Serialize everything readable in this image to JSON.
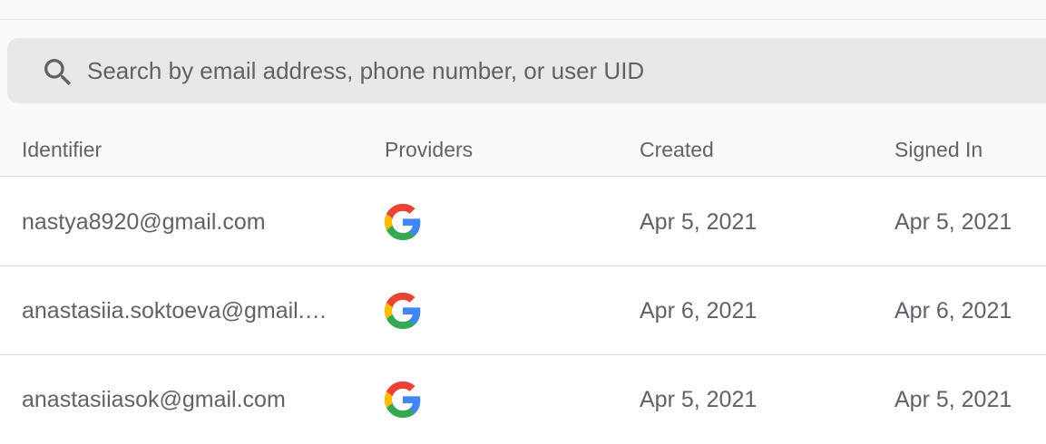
{
  "search": {
    "placeholder": "Search by email address, phone number, or user UID"
  },
  "table": {
    "columns": [
      "Identifier",
      "Providers",
      "Created",
      "Signed In"
    ],
    "rows": [
      {
        "identifier": "nastya8920@gmail.com",
        "provider": "google-icon",
        "created": "Apr 5, 2021",
        "signed_in": "Apr 5, 2021"
      },
      {
        "identifier": "anastasiia.soktoeva@gmail.…",
        "provider": "google-icon",
        "created": "Apr 6, 2021",
        "signed_in": "Apr 6, 2021"
      },
      {
        "identifier": "anastasiiasok@gmail.com",
        "provider": "google-icon",
        "created": "Apr 5, 2021",
        "signed_in": "Apr 5, 2021"
      }
    ]
  },
  "colors": {
    "google_blue": "#4285F4",
    "google_red": "#EA4335",
    "google_yellow": "#FBBC05",
    "google_green": "#34A853",
    "text": "#5f6368"
  }
}
